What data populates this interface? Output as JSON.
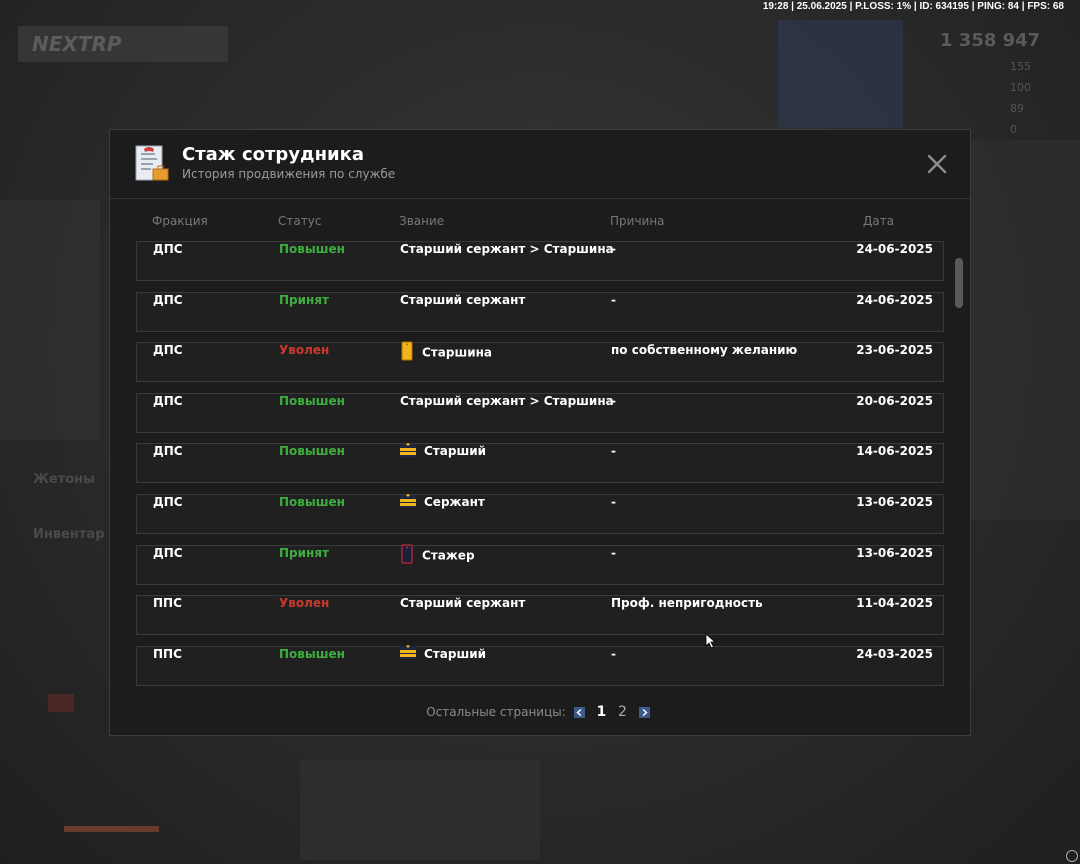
{
  "hud": {
    "text": "19:28 | 25.06.2025 | P.LOSS: 1% | ID: 634195 | PING: 84 | FPS: 68"
  },
  "background": {
    "logo": "NEXTRP",
    "money": "1 358 947",
    "stats": [
      "155",
      "100",
      "89",
      "0"
    ],
    "labels": {
      "tokens": "Жетоны",
      "inventory": "Инвентар"
    }
  },
  "modal": {
    "title": "Стаж сотрудника",
    "subtitle": "История продвижения по службе",
    "columns": {
      "faction": "Фракция",
      "status": "Статус",
      "rank": "Звание",
      "reason": "Причина",
      "date": "Дата"
    },
    "rows": [
      {
        "faction": "ДПС",
        "status": "Повышен",
        "status_color": "#3fae3f",
        "rank": "Старший сержант > Старшина",
        "rank_icon": "",
        "reason": "-",
        "date": "24-06-2025"
      },
      {
        "faction": "ДПС",
        "status": "Принят",
        "status_color": "#3fae3f",
        "rank": "Старший сержант",
        "rank_icon": "",
        "reason": "-",
        "date": "24-06-2025"
      },
      {
        "faction": "ДПС",
        "status": "Уволен",
        "status_color": "#c83a2e",
        "rank": "Старшина",
        "rank_icon": "shoulder-strap-yellow-icon",
        "reason": "по собственному желанию",
        "date": "23-06-2025"
      },
      {
        "faction": "ДПС",
        "status": "Повышен",
        "status_color": "#3fae3f",
        "rank": "Старший сержант > Старшина",
        "rank_icon": "",
        "reason": "-",
        "date": "20-06-2025"
      },
      {
        "faction": "ДПС",
        "status": "Повышен",
        "status_color": "#3fae3f",
        "rank": "Старший",
        "rank_icon": "chevron-stripes-icon",
        "reason": "-",
        "date": "14-06-2025"
      },
      {
        "faction": "ДПС",
        "status": "Повышен",
        "status_color": "#3fae3f",
        "rank": "Сержант",
        "rank_icon": "chevron-stripes-icon",
        "reason": "-",
        "date": "13-06-2025"
      },
      {
        "faction": "ДПС",
        "status": "Принят",
        "status_color": "#3fae3f",
        "rank": "Стажер",
        "rank_icon": "shoulder-strap-dark-icon",
        "reason": "-",
        "date": "13-06-2025"
      },
      {
        "faction": "ППС",
        "status": "Уволен",
        "status_color": "#c83a2e",
        "rank": "Старший сержант",
        "rank_icon": "",
        "reason": "Проф. непригодность",
        "date": "11-04-2025"
      },
      {
        "faction": "ППС",
        "status": "Повышен",
        "status_color": "#3fae3f",
        "rank": "Старший",
        "rank_icon": "chevron-stripes-icon",
        "reason": "-",
        "date": "24-03-2025"
      }
    ],
    "pager": {
      "label": "Остальные страницы:",
      "pages": [
        "1",
        "2"
      ],
      "current": "1"
    }
  }
}
